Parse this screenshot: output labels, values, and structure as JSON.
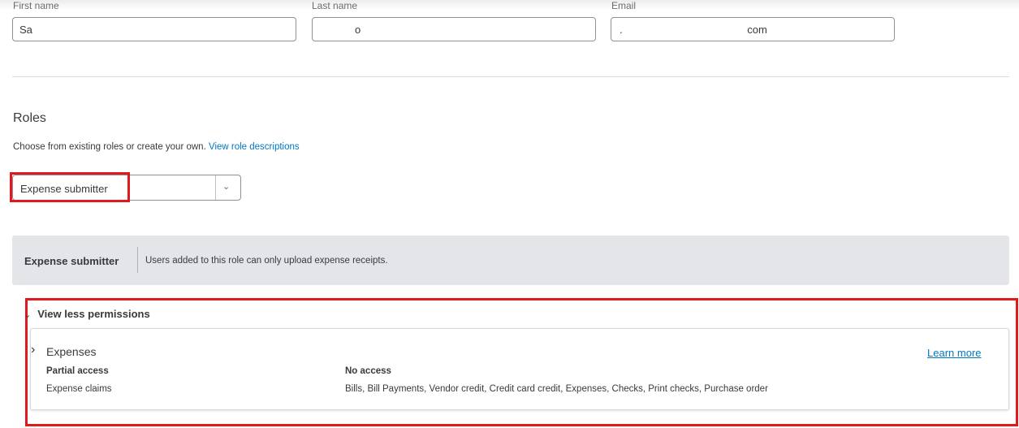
{
  "form": {
    "first_name": {
      "label": "First name",
      "value": "Sa"
    },
    "last_name": {
      "label": "Last name",
      "value": "o"
    },
    "email": {
      "label": "Email",
      "value": ". com"
    }
  },
  "roles": {
    "title": "Roles",
    "description": "Choose from existing roles or create your own.",
    "link": "View role descriptions",
    "selected": "Expense submitter"
  },
  "role_info": {
    "name": "Expense submitter",
    "description": "Users added to this role can only upload expense receipts."
  },
  "permissions": {
    "toggle_label": "View less permissions",
    "category": "Expenses",
    "learn_more": "Learn more",
    "partial_heading": "Partial access",
    "partial_items": "Expense claims",
    "none_heading": "No access",
    "none_items": "Bills, Bill Payments, Vendor credit, Credit card credit, Expenses, Checks, Print checks, Purchase order"
  },
  "colors": {
    "link": "#0077c5",
    "highlight": "#e0191f",
    "banner_bg": "#e4e5e8"
  }
}
